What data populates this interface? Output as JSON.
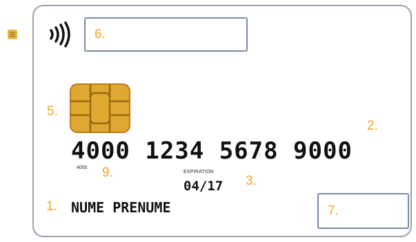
{
  "card": {
    "number": "4000 1234 5678 9000",
    "number_short": "4000",
    "expiration_label": "EXPIRATION",
    "expiration_date": "04/17",
    "holder_name": "NUME PRENUME"
  },
  "callouts": {
    "c1": "1.",
    "c2": "2.",
    "c3": "3.",
    "c5": "5.",
    "c6": "6.",
    "c7": "7.",
    "c9": "9."
  },
  "colors": {
    "callout": "#f5a623",
    "chip": "#e0a830",
    "box_border": "#7a8aa4"
  },
  "icons": [
    "contactless-icon",
    "chip-icon",
    "hologram-icon"
  ]
}
